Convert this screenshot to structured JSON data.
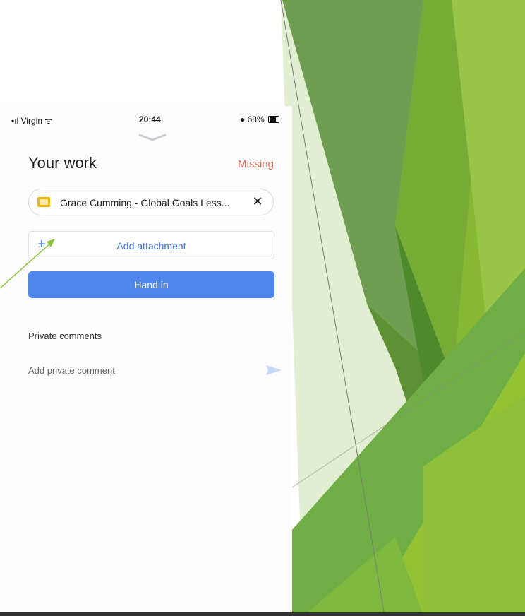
{
  "status_bar": {
    "carrier": "Virgin",
    "time": "20:44",
    "battery": "68%"
  },
  "work": {
    "title": "Your work",
    "status": "Missing",
    "attachment": {
      "name": "Grace Cumming - Global Goals Less...",
      "close_symbol": "✕",
      "icon": "slides-icon"
    },
    "add_attachment_label": "Add attachment",
    "add_attachment_symbol": "+",
    "hand_in_label": "Hand in"
  },
  "comments": {
    "section_title": "Private comments",
    "placeholder": "Add private comment",
    "send_icon": "send-icon"
  },
  "colors": {
    "accent_blue": "#4f86ec",
    "missing_red": "#e06b55",
    "slides_yellow": "#f2b705",
    "green_dark": "#5c9b3a",
    "green_light": "#96c83c"
  }
}
